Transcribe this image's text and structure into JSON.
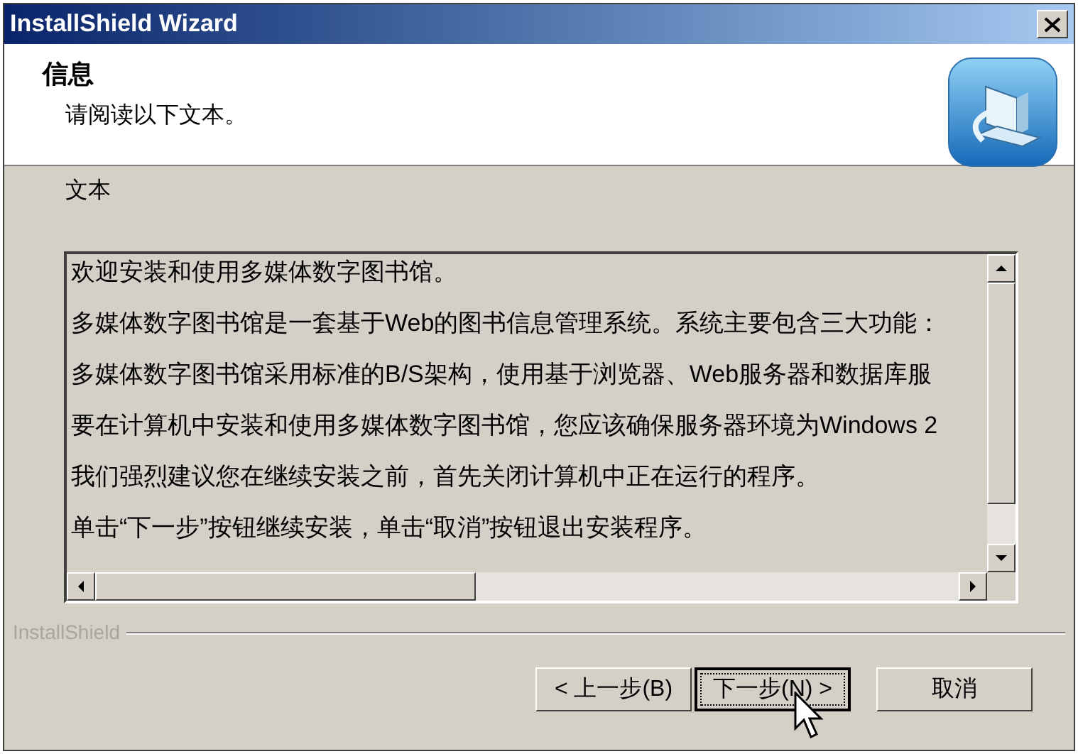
{
  "window": {
    "title": "InstallShield Wizard"
  },
  "header": {
    "title": "信息",
    "subtitle": "请阅读以下文本。"
  },
  "section_label": "文本",
  "text_lines": [
    "欢迎安装和使用多媒体数字图书馆。",
    "多媒体数字图书馆是一套基于Web的图书信息管理系统。系统主要包含三大功能：",
    "多媒体数字图书馆采用标准的B/S架构，使用基于浏览器、Web服务器和数据库服",
    "要在计算机中安装和使用多媒体数字图书馆，您应该确保服务器环境为Windows 2",
    "我们强烈建议您在继续安装之前，首先关闭计算机中正在运行的程序。",
    "单击“下一步”按钮继续安装，单击“取消”按钮退出安装程序。"
  ],
  "brand": "InstallShield",
  "buttons": [
    {
      "kind": "back",
      "label": "< 上一步(B)",
      "focused": false
    },
    {
      "kind": "next",
      "label": "下一步(N) >",
      "focused": true
    },
    {
      "kind": "cancel",
      "label": "取消",
      "focused": false
    }
  ]
}
